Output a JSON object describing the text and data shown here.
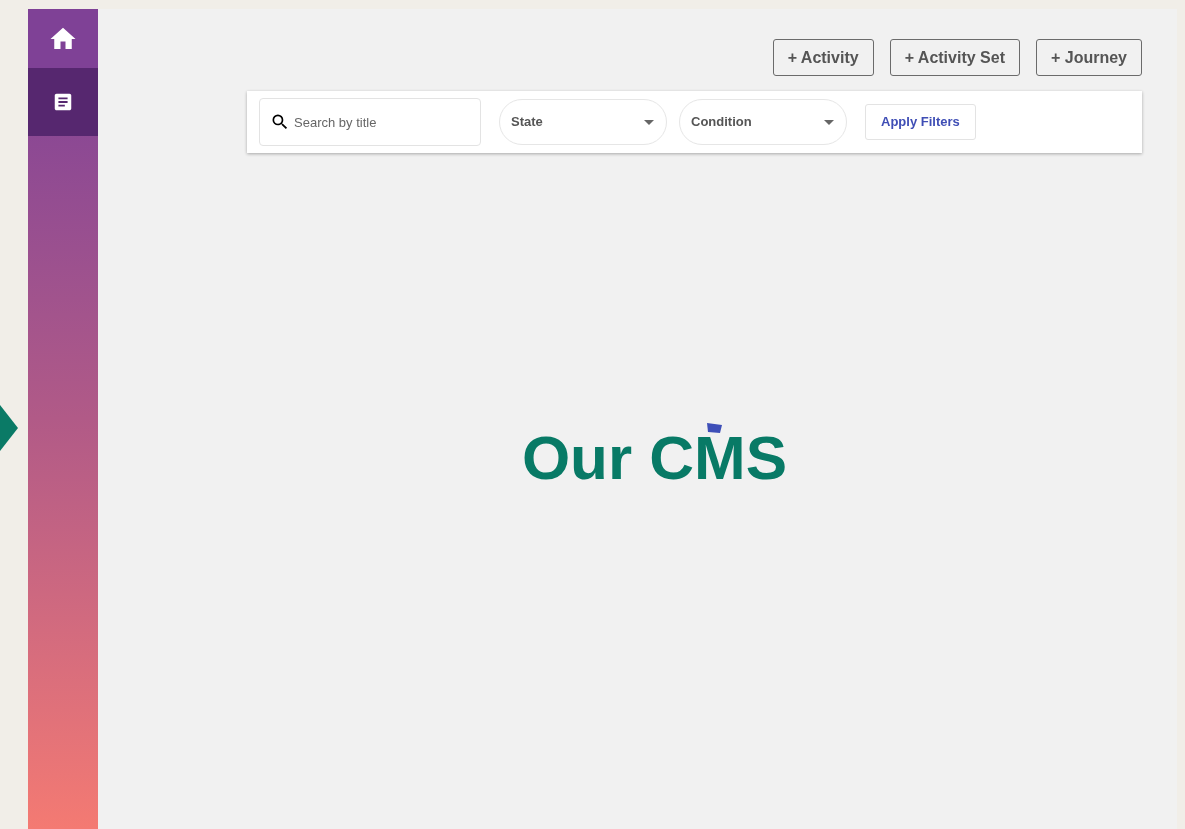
{
  "sidebar": {
    "items": [
      {
        "kind": "home",
        "selected": false
      },
      {
        "kind": "document",
        "selected": true
      }
    ]
  },
  "actions": [
    "+ Activity",
    "+ Activity Set",
    "+ Journey"
  ],
  "filters": {
    "search": {
      "placeholder": "Search by title"
    },
    "dropdowns": [
      {
        "label": "State"
      },
      {
        "label": "Condition"
      }
    ],
    "apply": "Apply Filters"
  },
  "logo": {
    "text": "Our CMS"
  }
}
